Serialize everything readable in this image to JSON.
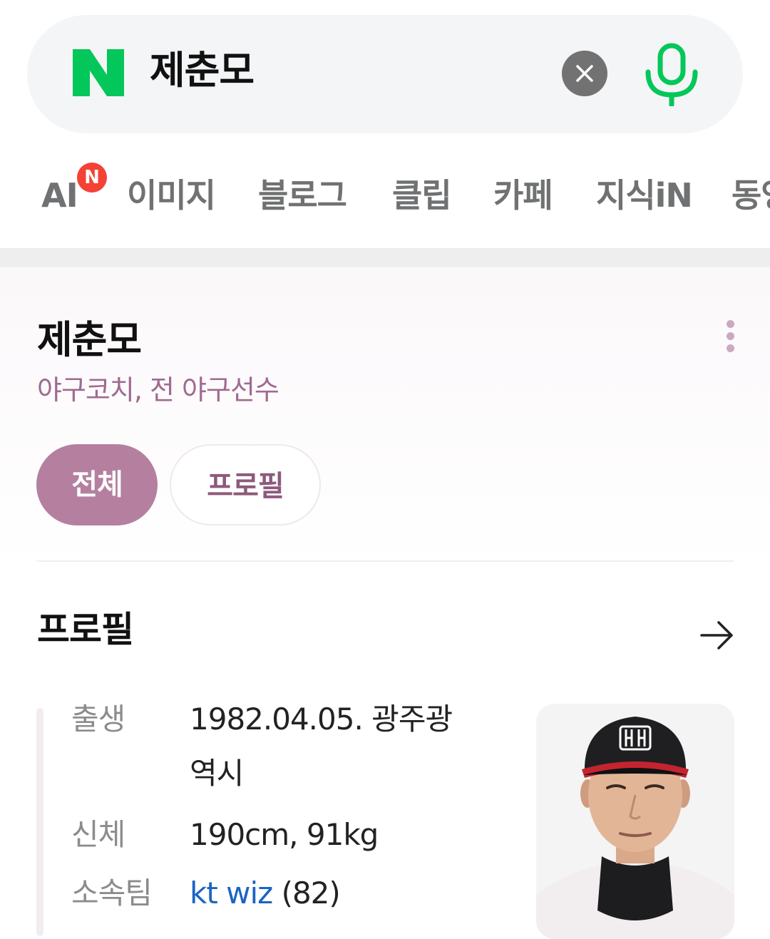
{
  "search": {
    "query": "제춘모",
    "logo_letter": "N",
    "clear_icon": "close-icon",
    "mic_icon": "microphone-icon"
  },
  "tabs": [
    {
      "label": "AI",
      "badge": "N"
    },
    {
      "label": "이미지"
    },
    {
      "label": "블로그"
    },
    {
      "label": "클립"
    },
    {
      "label": "카페"
    },
    {
      "label": "지식iN"
    },
    {
      "label": "동영"
    }
  ],
  "entity": {
    "name": "제춘모",
    "subtitle": "야구코치, 전 야구선수",
    "chips": [
      "전체",
      "프로필"
    ]
  },
  "profile": {
    "section_title": "프로필",
    "rows": {
      "birth": {
        "label": "출생",
        "value_line1": "1982.04.05. 광주광",
        "value_line2": "역시"
      },
      "body": {
        "label": "신체",
        "value": "190cm, 91kg"
      },
      "team": {
        "label": "소속팀",
        "team_name": "kt wiz",
        "number": "(82)"
      }
    }
  },
  "colors": {
    "brand_green": "#03c75a",
    "accent_mauve": "#b5809f",
    "badge_red": "#f44236",
    "link_blue": "#1b64c4"
  }
}
